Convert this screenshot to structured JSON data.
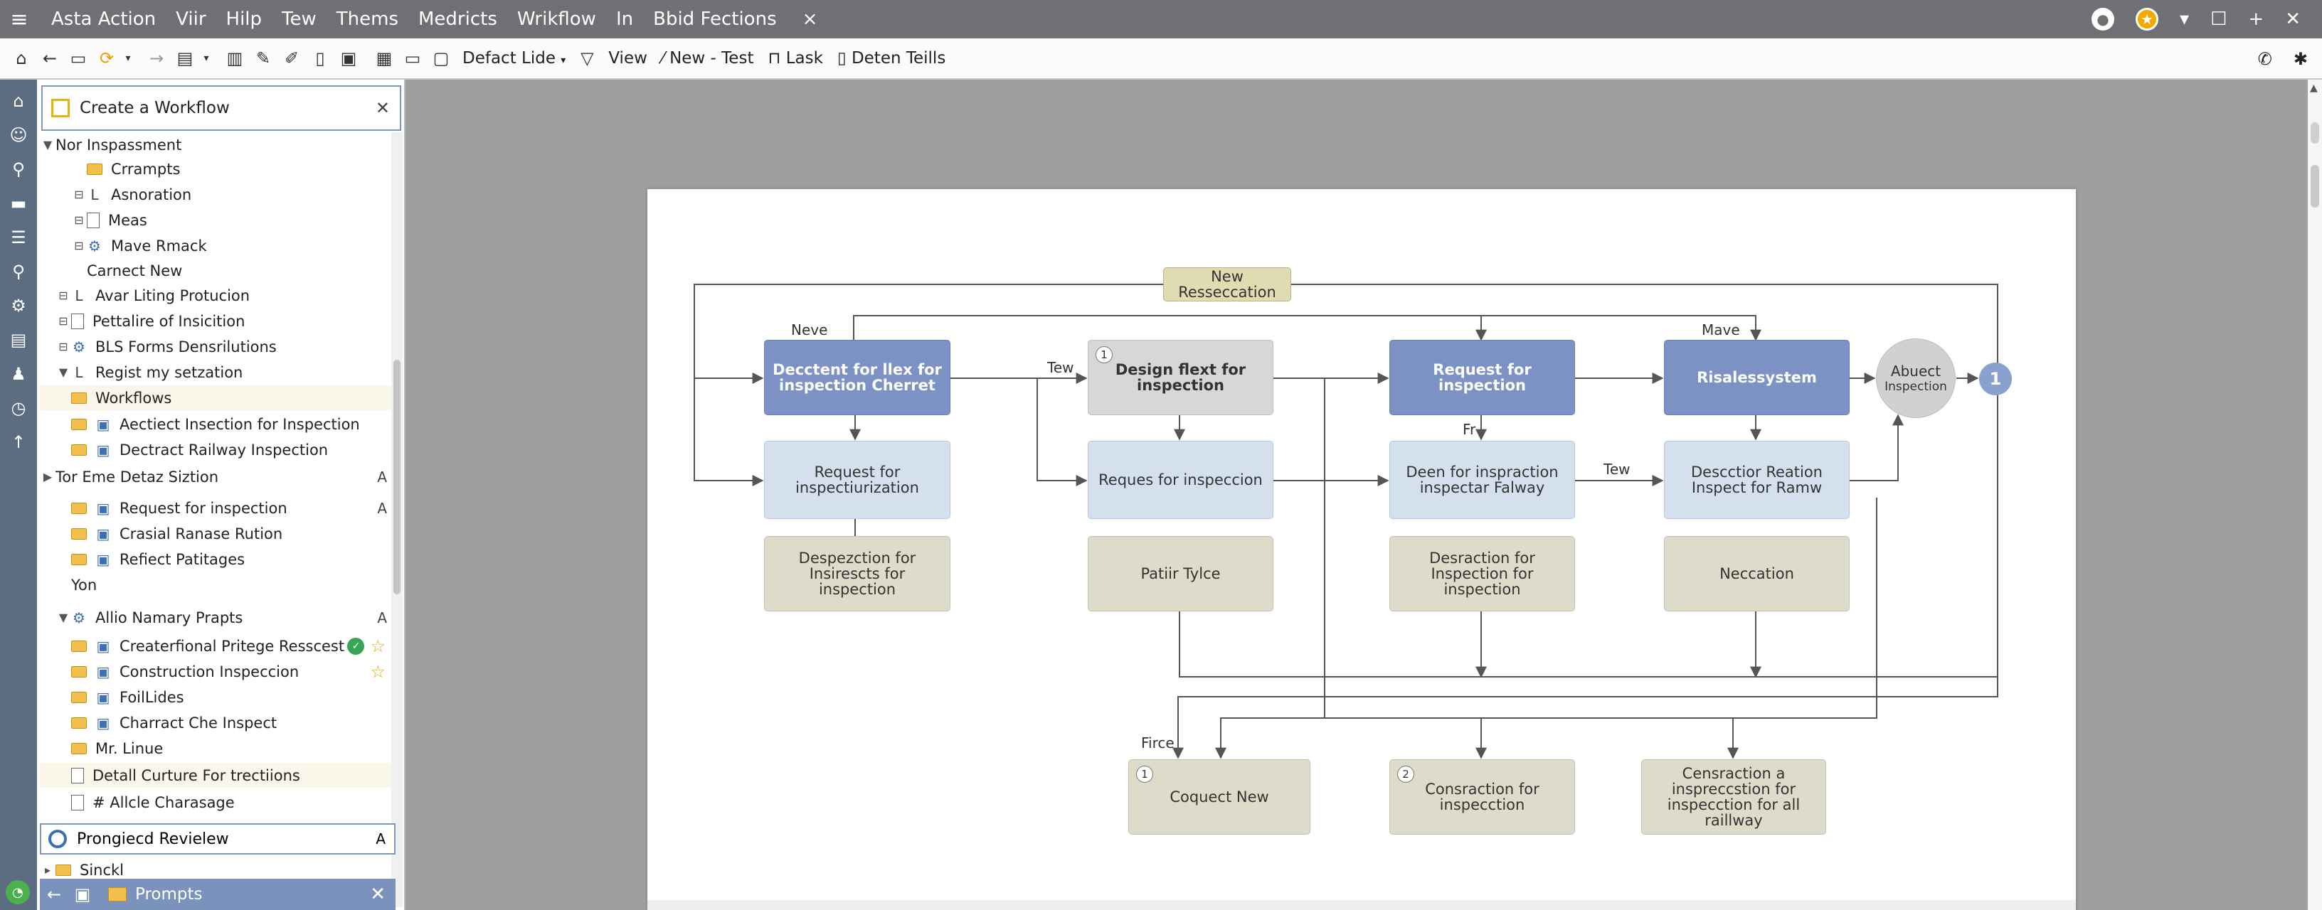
{
  "titlebar": {
    "menu": [
      "Asta Action",
      "Viir",
      "Hilp",
      "Tew",
      "Thems",
      "Medricts",
      "Wrikflow",
      "In",
      "Bbid Fections"
    ],
    "close_tab": "×"
  },
  "toolbar": {
    "layout_select": "Defact Lide",
    "view": "View",
    "new_test": "New - Test",
    "lask": "Lask",
    "deten": "Deten Teills"
  },
  "panel": {
    "title": "Create a Workflow",
    "tree": [
      {
        "label": "Nor Inspassment",
        "indent": 0,
        "type": "section",
        "twisty": "▼"
      },
      {
        "label": "Crrampts",
        "indent": 2,
        "type": "folder"
      },
      {
        "label": "Asnoration",
        "indent": 2,
        "type": "plain",
        "twisty": "⊟"
      },
      {
        "label": "Meas",
        "indent": 2,
        "type": "doc",
        "twisty": "⊟"
      },
      {
        "label": "Mave Rmack",
        "indent": 2,
        "type": "gear",
        "twisty": "⊟"
      },
      {
        "label": "Carnect New",
        "indent": 2,
        "type": "none"
      },
      {
        "label": "Avar Liting Protucion",
        "indent": 1,
        "type": "plain",
        "twisty": "⊟"
      },
      {
        "label": "Pettalire of Insicition",
        "indent": 1,
        "type": "doc",
        "twisty": "⊟"
      },
      {
        "label": "BLS Forms Densrilutions",
        "indent": 1,
        "type": "gear",
        "twisty": "⊟"
      },
      {
        "label": "Regist my setzation",
        "indent": 1,
        "type": "plain",
        "twisty": "▼"
      },
      {
        "label": "Workflows",
        "indent": 0,
        "type": "folder",
        "hl": true
      },
      {
        "label": "Aectiect Insection for Inspection",
        "indent": 0,
        "type": "folder2"
      },
      {
        "label": "Dectract Railway Inspection",
        "indent": 0,
        "type": "folder2"
      },
      {
        "label": "Tor Eme Detaz Siztion",
        "indent": 0,
        "type": "section",
        "twisty": "▶",
        "right": "A"
      },
      {
        "label": "Request for inspection",
        "indent": 0,
        "type": "folder2",
        "right": "A"
      },
      {
        "label": "Crasial Ranase Rution",
        "indent": 0,
        "type": "folder2"
      },
      {
        "label": "Refiect Patitages",
        "indent": 0,
        "type": "folder2"
      },
      {
        "label": "Yon",
        "indent": 0,
        "type": "none"
      },
      {
        "label": "Allio Namary Prapts",
        "indent": 0,
        "type": "gear",
        "twisty": "▼",
        "right": "A"
      },
      {
        "label": "Createrfional Pritege Resscest",
        "indent": 0,
        "type": "folder2",
        "ok": true,
        "star": true
      },
      {
        "label": "Construction Inspeccion",
        "indent": 0,
        "type": "folder2",
        "star": true
      },
      {
        "label": "FoilLides",
        "indent": 0,
        "type": "folder2"
      },
      {
        "label": "Charract Che Inspect",
        "indent": 0,
        "type": "folder2"
      },
      {
        "label": "Mr. Linue",
        "indent": 0,
        "type": "folder"
      },
      {
        "label": "Detall Curture For trectiions",
        "indent": 0,
        "type": "doc",
        "hl": true
      },
      {
        "label": "# Allcle Charasage",
        "indent": 0,
        "type": "doc"
      }
    ],
    "review": {
      "label": "Prongiecd Revielew",
      "right": "A"
    },
    "sinckl": "Sinckl",
    "prompts": "Prompts"
  },
  "flow": {
    "top_node": "New Resseccation",
    "labels": {
      "neve": "Neve",
      "tew1": "Tew",
      "mave": "Mave",
      "fr": "Fr",
      "tew2": "Tew",
      "firce": "Firce"
    },
    "row1": [
      {
        "text": "Decctent for llex for inspection Cherret"
      },
      {
        "text": "Design flext for inspection",
        "num": "1"
      },
      {
        "text": "Request for inspection"
      },
      {
        "text": "Risalessystem"
      }
    ],
    "abuect": {
      "line1": "Abuect",
      "line2": "Inspection"
    },
    "dot": "1",
    "row2": [
      {
        "text": "Request for inspectiurization"
      },
      {
        "text": "Reques for inspeccion"
      },
      {
        "text": "Deen for inspraction inspectar Falway"
      },
      {
        "text": "Descctior Reation Inspect for Ramw"
      }
    ],
    "row3": [
      {
        "text": "Despezction for Insirescts for inspection"
      },
      {
        "text": "Patiir Tylce"
      },
      {
        "text": "Desraction for Inspection for inspection"
      },
      {
        "text": "Neccation"
      }
    ],
    "row4": [
      {
        "text": "Coquect New",
        "num": "1"
      },
      {
        "text": "Consraction for inspecction",
        "num": "2"
      },
      {
        "text": "Censraction a inspreccstion for inspecction for all raillway"
      }
    ]
  },
  "colors": {
    "accent": "#7c91c4",
    "rail": "#5c6d82",
    "titlebar": "#6e7073"
  }
}
